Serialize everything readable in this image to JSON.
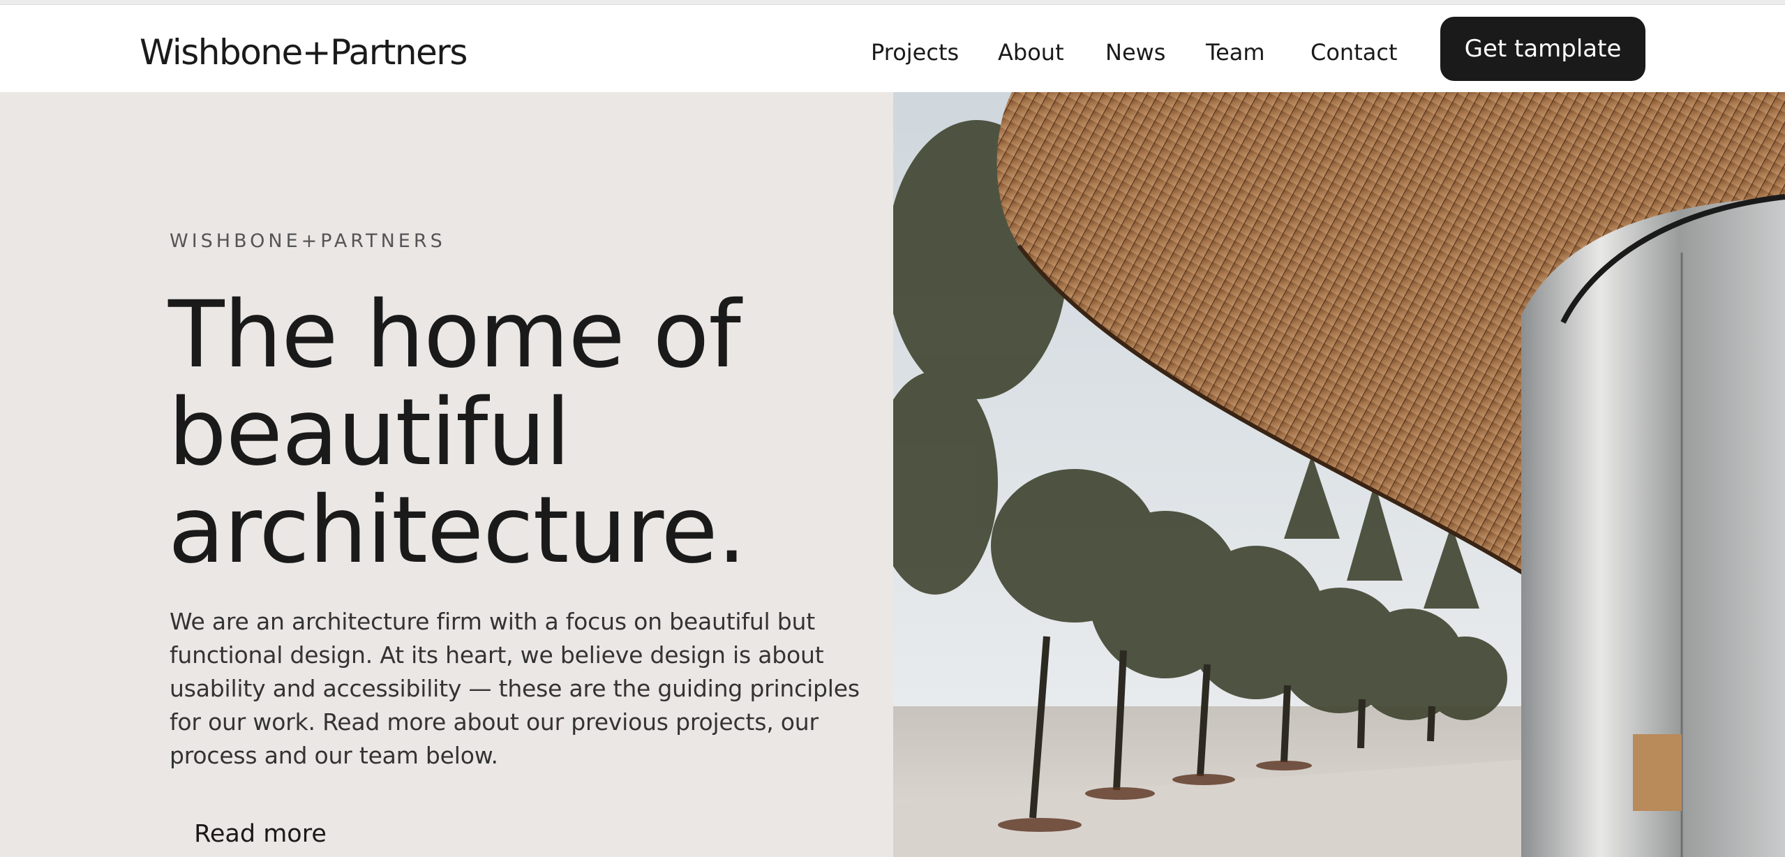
{
  "header": {
    "brand": "Wishbone+Partners",
    "nav": [
      {
        "label": "Projects"
      },
      {
        "label": "About"
      },
      {
        "label": "News"
      },
      {
        "label": "Team"
      },
      {
        "label": "Contact"
      }
    ],
    "cta_label": "Get tamplate"
  },
  "hero": {
    "eyebrow": "WISHBONE+PARTNERS",
    "headline_lines": [
      "The home of",
      "beautiful",
      "architecture."
    ],
    "lede_lines": [
      "We are an architecture firm with a focus on beautiful but",
      "functional design. At its heart, we believe design is about",
      "usability and accessibility — these are the guiding principles",
      "for our work. Read more about our previous projects, our",
      "process and our team below."
    ],
    "read_more_label": "Read more"
  },
  "colors": {
    "accent": "#1a1a1a",
    "hero_bg": "#ebe7e4",
    "text": "#1a1a1a",
    "canopy_wood": "#9c6a40"
  },
  "image": {
    "subject": "building-canopy-photo"
  }
}
